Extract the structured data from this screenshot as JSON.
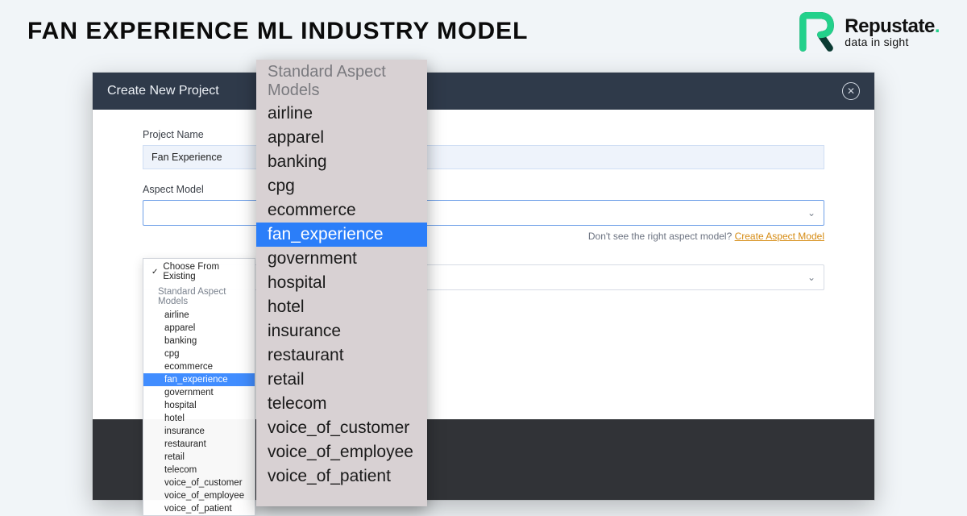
{
  "page": {
    "title": "FAN EXPERIENCE ML INDUSTRY MODEL"
  },
  "brand": {
    "name": "Repustate",
    "tagline": "data in sight"
  },
  "modal": {
    "title": "Create New Project",
    "project_name_label": "Project Name",
    "project_name_value": "Fan Experience",
    "aspect_model_label": "Aspect Model",
    "helper_prefix": "Don't see the right aspect model? ",
    "helper_link": "Create Aspect Model"
  },
  "small_dropdown": {
    "choose_label": "Choose From Existing",
    "group_label": "Standard Aspect Models",
    "items": [
      "airline",
      "apparel",
      "banking",
      "cpg",
      "ecommerce",
      "fan_experience",
      "government",
      "hospital",
      "hotel",
      "insurance",
      "restaurant",
      "retail",
      "telecom",
      "voice_of_customer",
      "voice_of_employee",
      "voice_of_patient"
    ],
    "selected": "fan_experience"
  },
  "big_dropdown": {
    "group_label": "Standard Aspect Models",
    "items": [
      "airline",
      "apparel",
      "banking",
      "cpg",
      "ecommerce",
      "fan_experience",
      "government",
      "hospital",
      "hotel",
      "insurance",
      "restaurant",
      "retail",
      "telecom",
      "voice_of_customer",
      "voice_of_employee",
      "voice_of_patient"
    ],
    "selected": "fan_experience"
  }
}
